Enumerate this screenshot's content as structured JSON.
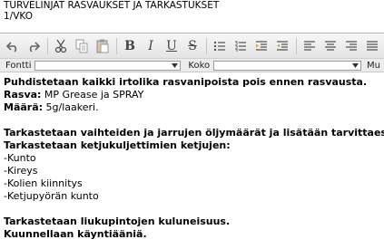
{
  "header": {
    "title": "TURVELINJAT RASVAUKSET JA TARKASTUKSET",
    "interval": "1/VKO"
  },
  "toolbar": {
    "buttons": [
      {
        "name": "undo-icon"
      },
      {
        "name": "redo-icon"
      },
      {
        "name": "cut-icon"
      },
      {
        "name": "copy-icon"
      },
      {
        "name": "paste-icon"
      },
      {
        "name": "bold-icon",
        "label": "B"
      },
      {
        "name": "italic-icon",
        "label": "I"
      },
      {
        "name": "underline-icon",
        "label": "U"
      },
      {
        "name": "strikethrough-icon",
        "label": "S"
      },
      {
        "name": "unordered-list-icon"
      },
      {
        "name": "ordered-list-icon"
      },
      {
        "name": "indent-icon"
      },
      {
        "name": "outdent-icon"
      },
      {
        "name": "align-left-icon"
      },
      {
        "name": "align-center-icon"
      },
      {
        "name": "align-right-icon"
      },
      {
        "name": "align-justify-icon"
      }
    ]
  },
  "fontbar": {
    "font_label": "Fontti",
    "size_label": "Koko",
    "more_label": "Mu"
  },
  "content": {
    "p1_bold": "Puhdistetaan kaikki irtolika rasvanipoista pois ennen rasvausta.",
    "grease_label": "Rasva:",
    "grease_value": " MP Grease ja SPRAY",
    "amount_label": "Määrä:",
    "amount_value": " 5g/laakeri.",
    "p2_line1": "Tarkastetaan vaihteiden ja jarrujen öljymäärät ja lisätään tarvittaessa.",
    "p2_line2": "Tarkastetaan ketjukuljettimien ketjujen:",
    "items": [
      "-Kunto",
      "-Kireys",
      "-Kolien kiinnitys",
      "-Ketjupyörän kunto"
    ],
    "p3_line1": "Tarkastetaan liukupintojen kuluneisuus.",
    "p3_line2": "Kuunnellaan käyntiääniä."
  }
}
